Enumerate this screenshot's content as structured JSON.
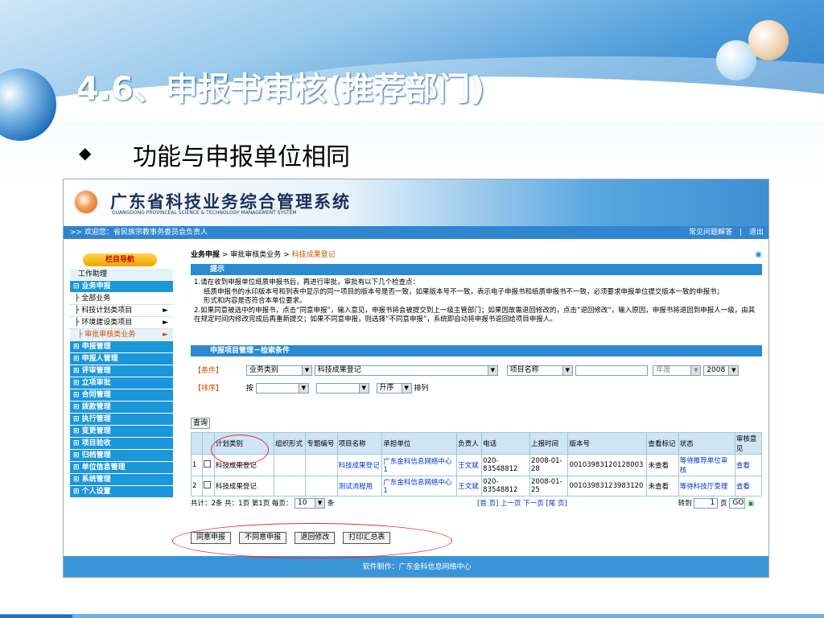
{
  "slide": {
    "title": "4.6、申报书审核(推荐部门)",
    "bullet": "◆",
    "subtitle": "功能与申报单位相同"
  },
  "app": {
    "name": "广东省科技业务综合管理系统",
    "name_en": "GUANGDONG PROVINCEAL SCIENCE & TECHNOLOGY MANAGEMENT SYSTEM",
    "welcome": ">> 欢迎您：省民族宗教事务委员会负责人",
    "faq_link": "常见问题解答",
    "separator": "|",
    "logout_link": "退出",
    "footer": "软件制作：广东金科信息网络中心"
  },
  "sidebar": {
    "header": "栏目导航",
    "items": [
      {
        "label": "工作助理",
        "type": "light"
      },
      {
        "label": "⊟ 业务申报",
        "type": "blue"
      },
      {
        "label": "├ 全部业务",
        "type": "sub"
      },
      {
        "label": "├ 科技计划类项目",
        "type": "sub",
        "arrow": "►"
      },
      {
        "label": "├ 环境建设类项目",
        "type": "sub",
        "arrow": "►"
      },
      {
        "label": "├ 审批审核类业务",
        "type": "active",
        "arrow": "►"
      },
      {
        "label": "⊞ 申报管理",
        "type": "blue"
      },
      {
        "label": "⊞ 申报人管理",
        "type": "blue"
      },
      {
        "label": "⊞ 评审管理",
        "type": "blue"
      },
      {
        "label": "⊞ 立项审批",
        "type": "blue"
      },
      {
        "label": "⊞ 合同管理",
        "type": "blue"
      },
      {
        "label": "⊞ 拨款管理",
        "type": "blue"
      },
      {
        "label": "⊞ 执行管理",
        "type": "blue"
      },
      {
        "label": "⊞ 变更管理",
        "type": "blue"
      },
      {
        "label": "⊞ 项目验收",
        "type": "blue"
      },
      {
        "label": "⊞ 归档管理",
        "type": "blue"
      },
      {
        "label": "⊞ 单位信息管理",
        "type": "blue"
      },
      {
        "label": "⊞ 系统管理",
        "type": "blue"
      },
      {
        "label": "⊞ 个人设置",
        "type": "blue"
      }
    ]
  },
  "breadcrumb": {
    "root": "业务申报",
    "sep1": " > ",
    "level2": "审批审核类业务",
    "sep2": " > ",
    "current": "科技成果登记"
  },
  "notice": {
    "header": "提示",
    "line1": "1.请在收到申报单位纸质申报书后，再进行审批，审批有以下几个检查点：",
    "line2": "纸质申报书的水印版本号和列表中显示的同一项目的版本号是否一致，如果版本号不一致，表示电子申报书和纸质申报书不一致，必须要求申报单位提交版本一致的申报书；",
    "line3": "形式和内容是否符合本单位要求。",
    "line4": "2.如果同意被选中的申报书，点击“同意申报”，输入意见，申报书将会被提交到上一级主管部门；如果因故需退回修改的，点击“退回修改”，输入原因，申报书将退回到申报人一级，由其在规定时间内修改完成后再重新提交；如果不同意申报，则选择“不同意申报”，系统即自动将申报书退回给项目申报人。"
  },
  "search": {
    "header": "申报项目管理－检索条件",
    "cond_label": "【条件】",
    "sort_label": "【排序】",
    "field1": "业务类别",
    "value1": "科技成果登记",
    "field2": "项目名称",
    "year_label": "年度",
    "year": "2008",
    "by": "按",
    "order": "升序",
    "order_suffix": "排列",
    "query_button": "查询"
  },
  "table": {
    "headers": [
      "",
      "",
      "计划类别",
      "组织形式",
      "专题编号",
      "项目名称",
      "承担单位",
      "负责人",
      "电话",
      "上报时间",
      "版本号",
      "查看标记",
      "状态",
      "审核意见"
    ],
    "rows": [
      {
        "no": "1",
        "category": "科技成果登记",
        "org": "",
        "topic": "",
        "name": "科技成果登记",
        "unit": "广东金科信息网络中心1",
        "person": "王文斌",
        "phone": "020-83548812",
        "date": "2008-01-28",
        "version": "00103983120128003",
        "mark": "未查看",
        "status": "等待推荐单位审核",
        "opinion": "查看"
      },
      {
        "no": "2",
        "category": "科技成果登记",
        "org": "",
        "topic": "",
        "name": "测试流程用",
        "unit": "广东金科信息网络中心1",
        "person": "王文斌",
        "phone": "020-83548812",
        "date": "2008-01-25",
        "version": "00103983123983120",
        "mark": "未查看",
        "status": "等待科技厅受理",
        "opinion": "查看"
      }
    ]
  },
  "pager": {
    "summary": "共计：2条 共：1页 第1页 每页：",
    "per_page": "10",
    "unit": "条",
    "nav": "[首 页] 上一页 下一页 [尾 页]",
    "goto_label": "转到",
    "goto_value": "1",
    "goto_unit": "页",
    "go": "GO"
  },
  "actions": {
    "approve": "同意申报",
    "reject": "不同意申报",
    "return": "退回修改",
    "print": "打印汇总表"
  }
}
